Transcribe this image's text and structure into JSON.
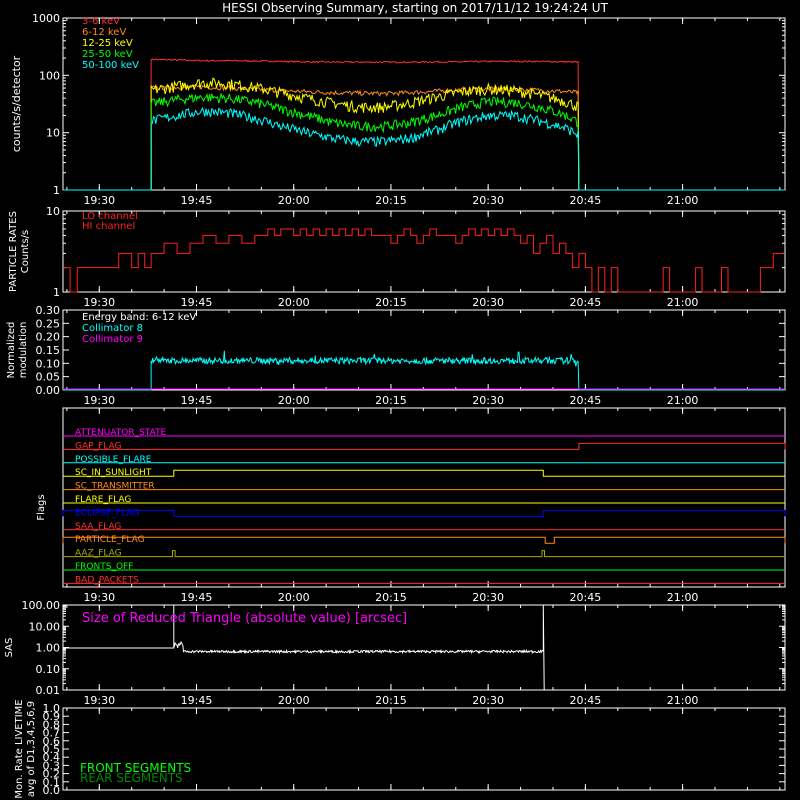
{
  "title": "HESSI Observing Summary, starting on 2017/11/12 19:24:24 UT",
  "time_axis": {
    "ticks": [
      "19:30",
      "19:45",
      "20:00",
      "20:15",
      "20:30",
      "20:45",
      "21:00"
    ],
    "tick_minutes": [
      30,
      45,
      60,
      75,
      90,
      105,
      120
    ],
    "minute_range": [
      24.4,
      135.8
    ]
  },
  "chart_data": [
    {
      "type": "line",
      "panel": "count-rates",
      "ylabel": "counts/s/detector",
      "yscale": "log",
      "ylim": [
        1,
        1000
      ],
      "yticks": [
        "1",
        "10",
        "100",
        "1000"
      ],
      "grid": false,
      "legend_placement": "top-left",
      "data_interval_minutes": [
        38.0,
        104.0
      ],
      "x": [
        38,
        42,
        46,
        50,
        54,
        58,
        62,
        66,
        70,
        74,
        78,
        82,
        86,
        90,
        94,
        98,
        102,
        104
      ],
      "series": [
        {
          "name": "3-6 keV",
          "color": "#ff3030",
          "values": [
            190,
            185,
            180,
            180,
            178,
            175,
            172,
            170,
            170,
            170,
            170,
            172,
            172,
            175,
            175,
            175,
            172,
            170
          ]
        },
        {
          "name": "6-12 keV",
          "color": "#ff8c1a",
          "values": [
            60,
            62,
            63,
            60,
            57,
            54,
            52,
            50,
            49,
            48,
            50,
            53,
            56,
            58,
            57,
            55,
            52,
            50
          ]
        },
        {
          "name": "12-25 keV",
          "color": "#ffff00",
          "values": [
            55,
            65,
            75,
            72,
            62,
            50,
            40,
            33,
            28,
            28,
            33,
            42,
            52,
            58,
            55,
            45,
            35,
            28
          ]
        },
        {
          "name": "25-50 keV",
          "color": "#00ff00",
          "values": [
            32,
            38,
            42,
            40,
            34,
            26,
            20,
            15,
            13,
            13,
            15,
            20,
            28,
            35,
            34,
            28,
            20,
            15
          ]
        },
        {
          "name": "50-100 keV",
          "color": "#00ffff",
          "values": [
            16,
            20,
            24,
            22,
            18,
            13,
            10,
            8,
            7,
            7,
            8,
            11,
            16,
            20,
            20,
            16,
            12,
            9
          ]
        }
      ]
    },
    {
      "type": "line",
      "panel": "particle-rates",
      "ylabel": "PARTICLE RATES",
      "ylabel2": "Counts/s",
      "yscale": "log",
      "ylim": [
        1,
        10
      ],
      "yticks": [
        "1",
        "10"
      ],
      "grid": false,
      "legend_placement": "top-left",
      "series": [
        {
          "name": "LO channel",
          "color": "#ff2020",
          "points": [
            [
              24.4,
              2
            ],
            [
              25.5,
              1
            ],
            [
              26.6,
              2
            ],
            [
              28.5,
              2
            ],
            [
              29.5,
              2
            ],
            [
              30.5,
              2
            ],
            [
              31.5,
              2
            ],
            [
              33,
              3
            ],
            [
              35,
              2
            ],
            [
              36,
              3
            ],
            [
              37,
              2
            ],
            [
              38,
              3
            ],
            [
              40,
              4
            ],
            [
              42,
              3
            ],
            [
              44,
              4
            ],
            [
              46,
              5
            ],
            [
              48,
              4
            ],
            [
              50,
              5
            ],
            [
              52,
              4
            ],
            [
              54,
              5
            ],
            [
              56,
              6
            ],
            [
              57,
              5
            ],
            [
              58,
              6
            ],
            [
              60,
              5
            ],
            [
              61,
              6
            ],
            [
              62,
              5
            ],
            [
              63,
              6
            ],
            [
              64,
              5
            ],
            [
              65,
              6
            ],
            [
              66,
              5
            ],
            [
              67,
              6
            ],
            [
              68,
              5
            ],
            [
              69,
              6
            ],
            [
              70,
              5
            ],
            [
              71,
              6
            ],
            [
              72,
              5
            ],
            [
              74,
              5
            ],
            [
              75,
              4
            ],
            [
              76,
              5
            ],
            [
              77,
              6
            ],
            [
              78,
              5
            ],
            [
              79,
              4
            ],
            [
              80,
              5
            ],
            [
              81,
              6
            ],
            [
              82,
              5
            ],
            [
              84,
              5
            ],
            [
              85,
              4
            ],
            [
              86,
              5
            ],
            [
              87,
              6
            ],
            [
              88,
              5
            ],
            [
              89,
              6
            ],
            [
              90,
              5
            ],
            [
              91,
              6
            ],
            [
              92,
              5
            ],
            [
              93,
              6
            ],
            [
              94,
              5
            ],
            [
              95,
              4
            ],
            [
              96,
              5
            ],
            [
              97,
              3
            ],
            [
              98,
              4
            ],
            [
              99,
              5
            ],
            [
              100,
              3
            ],
            [
              101,
              4
            ],
            [
              102,
              3
            ],
            [
              103,
              2
            ],
            [
              104,
              3
            ],
            [
              105,
              2
            ],
            [
              106,
              1
            ],
            [
              107,
              2
            ],
            [
              108,
              1
            ],
            [
              109,
              2
            ],
            [
              110,
              1
            ],
            [
              111,
              1
            ],
            [
              112,
              1
            ],
            [
              113,
              1
            ],
            [
              114,
              1
            ],
            [
              115,
              1
            ],
            [
              116,
              1
            ],
            [
              117,
              2
            ],
            [
              118,
              1
            ],
            [
              119,
              1
            ],
            [
              120,
              1
            ],
            [
              121,
              1
            ],
            [
              122,
              2
            ],
            [
              123,
              1
            ],
            [
              124,
              1
            ],
            [
              125,
              1
            ],
            [
              126,
              2
            ],
            [
              127,
              1
            ],
            [
              128,
              1
            ],
            [
              129,
              1
            ],
            [
              130,
              1
            ],
            [
              131,
              1
            ],
            [
              132,
              2
            ],
            [
              133,
              2
            ],
            [
              134,
              3
            ],
            [
              135.8,
              3
            ]
          ]
        },
        {
          "name": "HI channel",
          "color": "#ff2020",
          "points": []
        }
      ]
    },
    {
      "type": "line",
      "panel": "modulation",
      "ylabel": "Normalized",
      "ylabel2": "modulation",
      "yscale": "linear",
      "ylim": [
        0,
        0.3
      ],
      "yticks": [
        "0.00",
        "0.05",
        "0.10",
        "0.15",
        "0.20",
        "0.25",
        "0.30"
      ],
      "grid": false,
      "annotation": "Energy band: 6-12 keV",
      "legend_placement": "top-left",
      "data_interval_minutes": [
        38.0,
        104.0
      ],
      "series": [
        {
          "name": "Collimator 8",
          "color": "#00ffff",
          "mean": 0.11,
          "spread": 0.012
        },
        {
          "name": "Collimator 9",
          "color": "#ff00ff",
          "mean": 0.0
        }
      ]
    },
    {
      "type": "line",
      "panel": "flags",
      "ylabel": "Flags",
      "grid": false,
      "series": [
        {
          "name": "ATTENUATOR_STATE",
          "color": "#ff00ff",
          "segments": []
        },
        {
          "name": "GAP_FLAG",
          "color": "#ff3030",
          "segments": [
            [
              104.0,
              135.8
            ]
          ]
        },
        {
          "name": "POSSIBLE_FLARE",
          "color": "#00ffff",
          "segments": []
        },
        {
          "name": "SC_IN_SUNLIGHT",
          "color": "#ffff00",
          "segments": [
            [
              41.5,
              98.5
            ]
          ]
        },
        {
          "name": "SC_TRANSMITTER",
          "color": "#ff8c1a",
          "segments": []
        },
        {
          "name": "FLARE_FLAG",
          "color": "#ffff00",
          "segments": []
        },
        {
          "name": "ECLIPSE_FLAG",
          "color": "#0000ff",
          "segments": [
            [
              24.4,
              41.5
            ],
            [
              98.5,
              135.8
            ]
          ]
        },
        {
          "name": "SAA_FLAG",
          "color": "#ff3030",
          "segments": []
        },
        {
          "name": "PARTICLE_FLAG",
          "color": "#ff8c1a",
          "segments": [
            [
              24.4,
              98.8
            ],
            [
              100.2,
              135.8
            ]
          ]
        },
        {
          "name": "AAZ_FLAG",
          "color": "#aaaa00",
          "segments": [
            [
              41.3,
              41.7
            ],
            [
              98.3,
              98.7
            ]
          ]
        },
        {
          "name": "FRONTS_OFF",
          "color": "#00ff00",
          "segments": []
        },
        {
          "name": "BAD_PACKETS",
          "color": "#ff3030",
          "segments": []
        }
      ]
    },
    {
      "type": "line",
      "panel": "sas",
      "ylabel": "SAS",
      "yscale": "log",
      "ylim": [
        0.01,
        100
      ],
      "yticks": [
        "0.01",
        "0.10",
        "1.00",
        "10.00",
        "100.00"
      ],
      "grid": false,
      "annotation": "Size of Reduced Triangle (absolute value) [arcsec]",
      "series": [
        {
          "name": "SAS",
          "color": "#ffffff",
          "pre_value": 0.95,
          "spike_minutes": [
            41.5,
            98.5
          ],
          "mean": 0.65
        }
      ]
    },
    {
      "type": "line",
      "panel": "livetime",
      "ylabel": "Mon. Rate LIVETIME",
      "ylabel2": "avg of D1,3,4,5,6,9",
      "yscale": "linear",
      "ylim": [
        0,
        1
      ],
      "yticks": [
        "0.0",
        "0.1",
        "0.2",
        "0.3",
        "0.4",
        "0.5",
        "0.6",
        "0.7",
        "0.8",
        "0.9",
        "1.0"
      ],
      "grid": false,
      "legend_placement": "bottom-left",
      "series": [
        {
          "name": "FRONT SEGMENTS",
          "color": "#00ff00",
          "values": []
        },
        {
          "name": "REAR SEGMENTS",
          "color": "#008800",
          "values": []
        }
      ]
    }
  ]
}
